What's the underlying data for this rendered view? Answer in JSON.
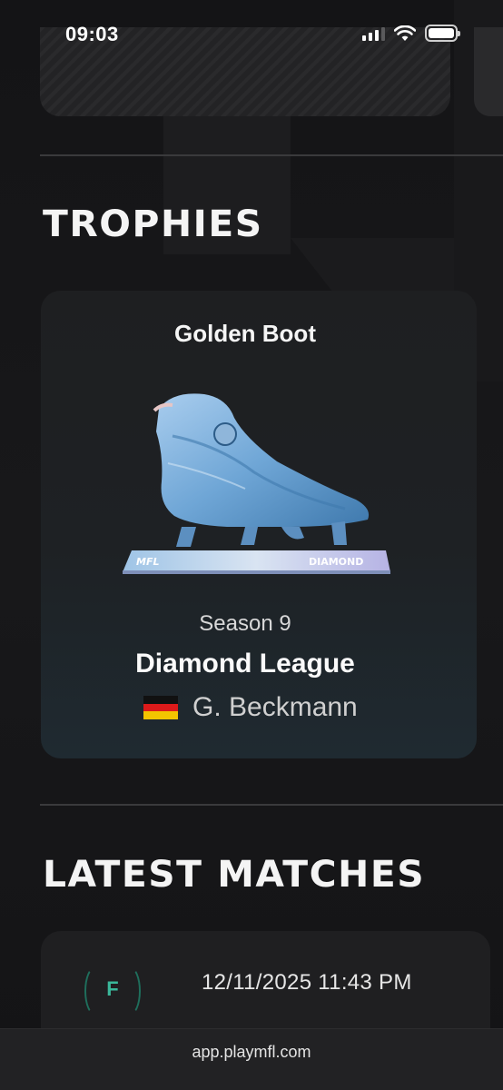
{
  "status_bar": {
    "time": "09:03",
    "icons": [
      "cellular-signal-icon",
      "wifi-icon",
      "battery-icon"
    ]
  },
  "sections": {
    "trophies_title": "TROPHIES",
    "latest_matches_title": "LATEST MATCHES"
  },
  "trophy": {
    "name": "Golden Boot",
    "plaque_left": "MFL",
    "plaque_right": "DIAMOND",
    "season": "Season 9",
    "league": "Diamond League",
    "player_name": "G. Beckmann",
    "flag": "germany-flag-icon"
  },
  "match": {
    "result_badge": "F",
    "datetime": "12/11/2025 11:43 PM"
  },
  "browser": {
    "url": "app.playmfl.com"
  },
  "colors": {
    "background": "#141416",
    "card": "#1e1f21",
    "accent_teal": "#3ab79a",
    "boot_blue": "#6fa6d6"
  }
}
